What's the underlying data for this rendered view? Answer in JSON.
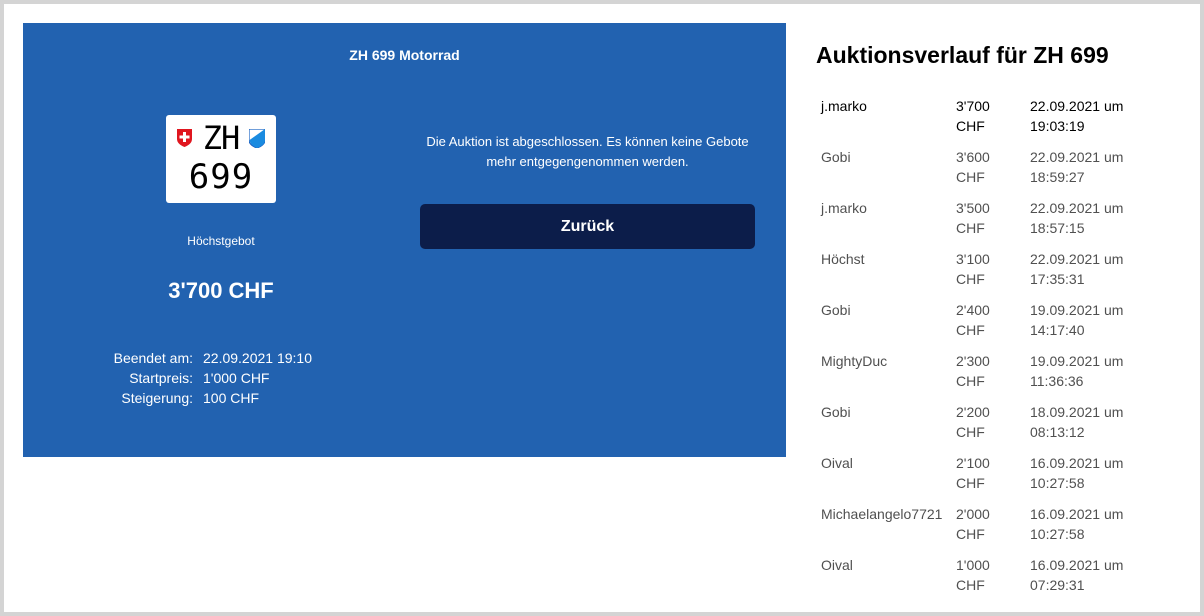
{
  "plate_card": {
    "title": "ZH 699 Motorrad",
    "plate_canton": "ZH",
    "plate_number": "699",
    "highest_bid_label": "Höchstgebot",
    "highest_bid_value": "3'700 CHF",
    "details": [
      {
        "key": "Beendet am:",
        "value": "22.09.2021 19:10"
      },
      {
        "key": "Startpreis:",
        "value": "1'000 CHF"
      },
      {
        "key": "Steigerung:",
        "value": "100 CHF"
      }
    ],
    "closed_message": "Die Auktion ist abgeschlossen. Es können keine Gebote mehr entgegengenommen werden.",
    "back_label": "Zurück",
    "colors": {
      "panel": "#2262b0",
      "button": "#0c1d4a"
    }
  },
  "history": {
    "title": "Auktionsverlauf für ZH 699",
    "rows": [
      {
        "name": "j.marko",
        "amount": "3'700",
        "currency": "CHF",
        "date": "22.09.2021 um",
        "time": "19:03:19"
      },
      {
        "name": "Gobi",
        "amount": "3'600",
        "currency": "CHF",
        "date": "22.09.2021 um",
        "time": "18:59:27"
      },
      {
        "name": "j.marko",
        "amount": "3'500",
        "currency": "CHF",
        "date": "22.09.2021 um",
        "time": "18:57:15"
      },
      {
        "name": "Höchst",
        "amount": "3'100",
        "currency": "CHF",
        "date": "22.09.2021 um",
        "time": "17:35:31"
      },
      {
        "name": "Gobi",
        "amount": "2'400",
        "currency": "CHF",
        "date": "19.09.2021 um",
        "time": "14:17:40"
      },
      {
        "name": "MightyDuc",
        "amount": "2'300",
        "currency": "CHF",
        "date": "19.09.2021 um",
        "time": "11:36:36"
      },
      {
        "name": "Gobi",
        "amount": "2'200",
        "currency": "CHF",
        "date": "18.09.2021 um",
        "time": "08:13:12"
      },
      {
        "name": "Oival",
        "amount": "2'100",
        "currency": "CHF",
        "date": "16.09.2021 um",
        "time": "10:27:58"
      },
      {
        "name": "Michaelangelo7721",
        "amount": "2'000",
        "currency": "CHF",
        "date": "16.09.2021 um",
        "time": "10:27:58"
      },
      {
        "name": "Oival",
        "amount": "1'000",
        "currency": "CHF",
        "date": "16.09.2021 um",
        "time": "07:29:31"
      }
    ]
  },
  "icons": [
    "swiss-flag-shield-icon",
    "zurich-canton-shield-icon"
  ]
}
